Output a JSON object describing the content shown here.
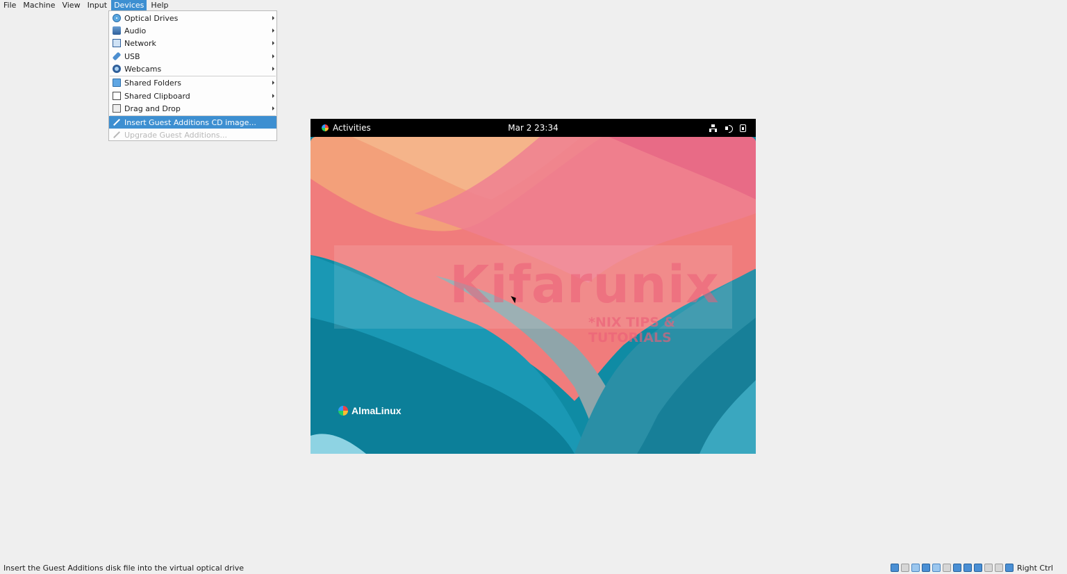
{
  "menubar": {
    "items": [
      "File",
      "Machine",
      "View",
      "Input",
      "Devices",
      "Help"
    ],
    "active": "Devices"
  },
  "devices_menu": {
    "items": [
      {
        "label": "Optical Drives",
        "icon": "optical-disc-icon",
        "submenu": true
      },
      {
        "label": "Audio",
        "icon": "audio-icon",
        "submenu": true
      },
      {
        "label": "Network",
        "icon": "network-icon",
        "submenu": true
      },
      {
        "label": "USB",
        "icon": "usb-icon",
        "submenu": true
      },
      {
        "label": "Webcams",
        "icon": "webcam-icon",
        "submenu": true
      },
      {
        "label": "Shared Folders",
        "icon": "shared-folder-icon",
        "submenu": true
      },
      {
        "label": "Shared Clipboard",
        "icon": "clipboard-icon",
        "submenu": true
      },
      {
        "label": "Drag and Drop",
        "icon": "drag-drop-icon",
        "submenu": true
      },
      {
        "label": "Insert Guest Additions CD image...",
        "icon": "insert-cd-icon",
        "highlighted": true
      },
      {
        "label": "Upgrade Guest Additions...",
        "icon": "upgrade-icon",
        "disabled": true
      }
    ]
  },
  "vm": {
    "topbar": {
      "activities": "Activities",
      "clock": "Mar 2  23:34",
      "icons": [
        "network-status-icon",
        "volume-icon",
        "battery-icon"
      ]
    },
    "watermark": {
      "title": "Kifarunix",
      "subtitle": "*NIX TIPS & TUTORIALS"
    },
    "brand": "AlmaLinux",
    "colors": {
      "teal": "#0e8aa3",
      "coral": "#f0747a",
      "peach": "#f2a88a"
    }
  },
  "statusbar": {
    "message": "Insert the Guest Additions disk file into the virtual optical drive",
    "host_key": "Right Ctrl",
    "indicators": [
      "hard-disk-icon",
      "optical-drive-icon",
      "audio-status-icon",
      "network-status-icon",
      "usb-status-icon",
      "shared-folders-status-icon",
      "display-status-icon",
      "recording-icon",
      "network-adapter-icon",
      "cpu-icon",
      "mouse-integration-icon",
      "keyboard-capture-icon"
    ]
  }
}
